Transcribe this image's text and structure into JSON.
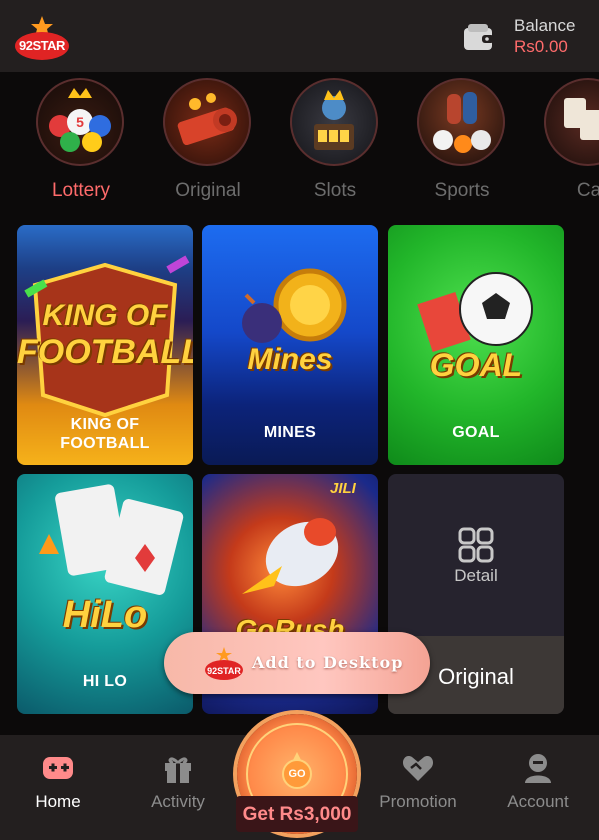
{
  "header": {
    "logo_text": "92STAR",
    "balance_label": "Balance",
    "balance_value": "Rs0.00"
  },
  "categories": [
    {
      "label": "Lottery",
      "active": true,
      "icon": "lottery-balls-icon"
    },
    {
      "label": "Original",
      "active": false,
      "icon": "original-games-icon"
    },
    {
      "label": "Slots",
      "active": false,
      "icon": "slots-machine-icon"
    },
    {
      "label": "Sports",
      "active": false,
      "icon": "sports-balls-icon"
    },
    {
      "label": "Ca",
      "active": false,
      "icon": "casino-cards-icon"
    }
  ],
  "games": [
    {
      "name": "KING OF\nFOOTBALL",
      "title": "KING OF FOOTBALL"
    },
    {
      "name": "MINES",
      "title": "Mines"
    },
    {
      "name": "GOAL",
      "title": "GOAL"
    },
    {
      "name": "HI LO",
      "title": "HiLo"
    },
    {
      "name": "",
      "title": "GoRush",
      "badge": "JILI"
    }
  ],
  "detail_card": {
    "label": "Detail",
    "category": "Original"
  },
  "add_to_desktop": {
    "label": "Add to Desktop",
    "logo_text": "92STAR"
  },
  "tabs": [
    {
      "label": "Home",
      "active": true
    },
    {
      "label": "Activity",
      "active": false
    },
    {
      "label": "Promotion",
      "active": false
    },
    {
      "label": "Account",
      "active": false
    }
  ],
  "wheel": {
    "go_label": "GO",
    "bonus_text": "Get Rs3,000"
  },
  "colors": {
    "accent": "#ff6b6b",
    "header_bg": "#231f1f",
    "page_bg": "#0c0a0a"
  }
}
